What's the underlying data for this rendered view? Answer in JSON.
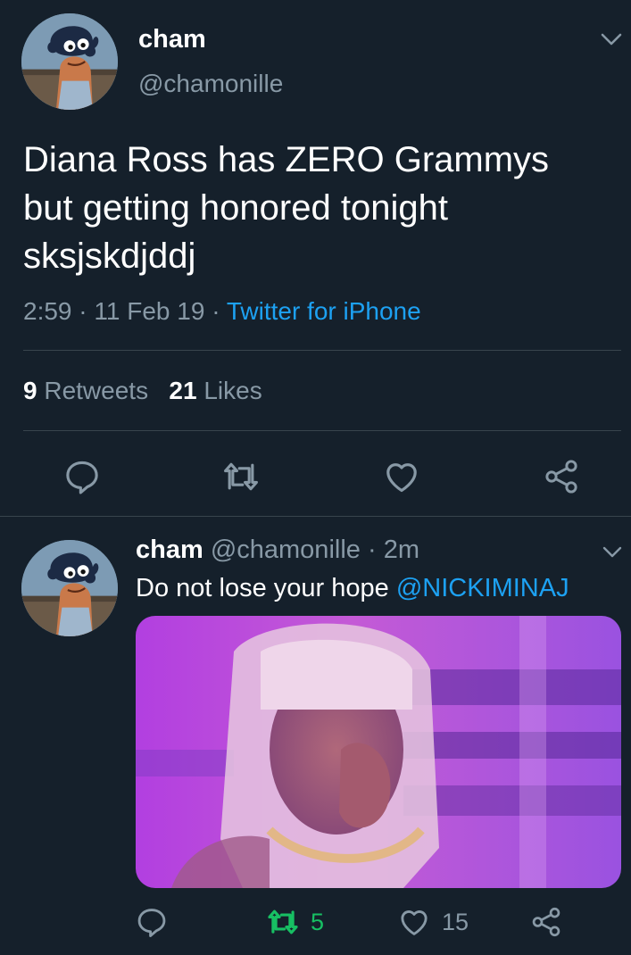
{
  "colors": {
    "background": "#15202b",
    "text_primary": "#ffffff",
    "text_secondary": "#8899a6",
    "link": "#1da1f2",
    "retweeted": "#17bf63",
    "divider": "#38444d"
  },
  "main_tweet": {
    "display_name": "cham",
    "handle": "@chamonille",
    "text": "Diana Ross has ZERO Grammys\nbut getting honored tonight\nsksjskdjddj",
    "time": "2:59",
    "date": "11 Feb 19",
    "separator": " · ",
    "source": "Twitter for iPhone",
    "retweets_count": "9",
    "retweets_label": "Retweets",
    "likes_count": "21",
    "likes_label": "Likes",
    "icons": {
      "avatar": "avatar-cartoon-icon",
      "menu": "chevron-down-icon",
      "reply": "reply-icon",
      "retweet": "retweet-icon",
      "like": "heart-icon",
      "share": "share-icon"
    }
  },
  "reply_tweet": {
    "display_name": "cham",
    "handle": "@chamonille",
    "time_ago": "2m",
    "separator": " · ",
    "text": "Do not lose your hope ",
    "mention": "@NICKIMINAJ",
    "retweets_count": "5",
    "likes_count": "15",
    "icons": {
      "media": "photo-image",
      "reply": "reply-icon",
      "retweet": "retweet-icon",
      "like": "heart-icon",
      "share": "share-icon"
    }
  }
}
